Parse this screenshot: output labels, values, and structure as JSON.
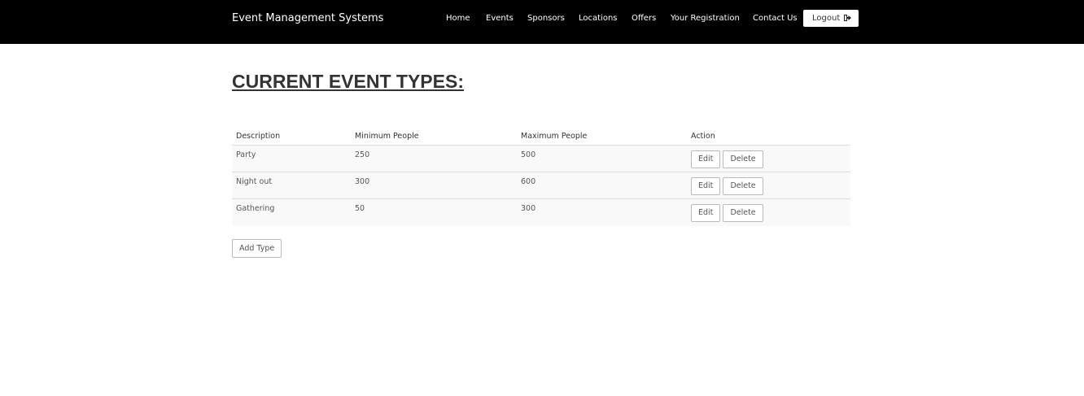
{
  "navbar": {
    "brand": "Event Management Systems",
    "items": [
      {
        "label": "Home"
      },
      {
        "label": "Events"
      },
      {
        "label": "Sponsors"
      },
      {
        "label": "Locations"
      },
      {
        "label": "Offers"
      },
      {
        "label": "Your Registration"
      },
      {
        "label": "Contact Us"
      }
    ],
    "logout_label": "Logout",
    "logout_icon": "sign-out-icon"
  },
  "main": {
    "title": "CURRENT EVENT TYPES:",
    "table": {
      "headers": [
        "Description",
        "Minimum People",
        "Maximum People",
        "Action"
      ],
      "rows": [
        {
          "description": "Party",
          "min": "250",
          "max": "500"
        },
        {
          "description": "Night out",
          "min": "300",
          "max": "600"
        },
        {
          "description": "Gathering",
          "min": "50",
          "max": "300"
        }
      ],
      "edit_label": "Edit",
      "delete_label": "Delete"
    },
    "add_type_label": "Add Type"
  }
}
